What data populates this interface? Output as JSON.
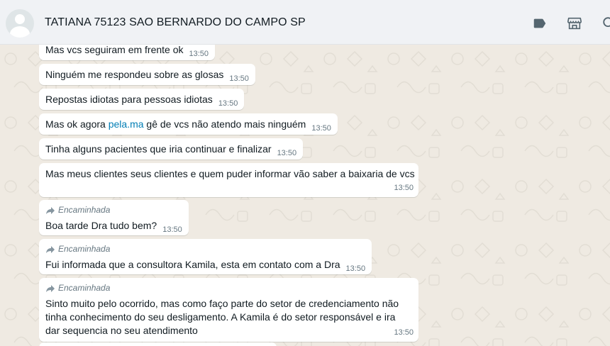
{
  "header": {
    "contact_name": "TATIANA 75123 SAO BERNARDO DO CAMPO SP"
  },
  "icons": {
    "label": "label-icon",
    "store": "store-icon",
    "search": "search-icon"
  },
  "messages": [
    {
      "text": "Mas vcs seguiram em frente ok",
      "time": "13:50"
    },
    {
      "text": "Ninguém me respondeu sobre as glosas",
      "time": "13:50"
    },
    {
      "text": "Repostas idiotas para pessoas idiotas",
      "time": "13:50"
    },
    {
      "text_before": "Mas ok agora ",
      "link": "pela.ma",
      "text_after": " gê de vcs não atendo mais ninguém",
      "time": "13:50"
    },
    {
      "text": "Tinha alguns pacientes que iria continuar e finalizar",
      "time": "13:50"
    },
    {
      "text": "Mas meus clientes seus clientes e quem puder informar vão saber a baixaria de vcs",
      "time": "13:50"
    },
    {
      "forwarded": "Encaminhada",
      "text": "Boa tarde Dra tudo bem?",
      "time": "13:50"
    },
    {
      "forwarded": "Encaminhada",
      "text": "Fui informada que a consultora Kamila, esta em contato com a Dra",
      "time": "13:50"
    },
    {
      "forwarded": "Encaminhada",
      "text": "Sinto muito pelo ocorrido, mas como faço parte do setor de credenciamento não tinha conhecimento do seu desligamento. A Kamila é do setor responsável e ira dar sequencia no seu atendimento",
      "time": "13:50"
    }
  ]
}
